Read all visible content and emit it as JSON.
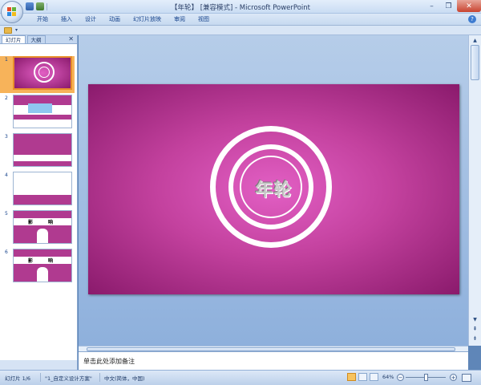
{
  "window": {
    "title": "【年轮】 [兼容模式] - Microsoft PowerPoint",
    "minimize": "–",
    "restore": "❐",
    "close": "✕"
  },
  "ribbon": {
    "tabs": [
      "开始",
      "插入",
      "设计",
      "动画",
      "幻灯片放映",
      "审阅",
      "视图"
    ],
    "help": "?"
  },
  "slides_panel": {
    "tabs": [
      "幻灯片",
      "大纲"
    ],
    "close": "✕",
    "thumbnails": [
      {
        "num": "1",
        "label_a": "",
        "label_b": ""
      },
      {
        "num": "2",
        "label_a": "",
        "label_b": ""
      },
      {
        "num": "3",
        "label_a": "",
        "label_b": ""
      },
      {
        "num": "4",
        "label_a": "",
        "label_b": ""
      },
      {
        "num": "5",
        "label_a": "影",
        "label_b": "响"
      },
      {
        "num": "6",
        "label_a": "影",
        "label_b": "响"
      }
    ]
  },
  "slide": {
    "title": "年轮"
  },
  "notes": {
    "placeholder": "单击此处添加备注"
  },
  "status": {
    "slide_count": "幻灯片 1/6",
    "theme": "\"1_自定义设计方案\"",
    "language": "中文(简体，中国)",
    "zoom": "64%",
    "zoom_minus": "−",
    "zoom_plus": "+"
  },
  "scroll": {
    "up": "▲",
    "down": "▼",
    "prev": "⇞",
    "next": "⇟"
  },
  "colors": {
    "slide_center": "#e25fc4",
    "slide_edge": "#8a1a6c",
    "selection": "#f7b35a"
  },
  "icons": [
    "office-button-icon",
    "save-icon",
    "undo-icon",
    "folder-icon",
    "help-icon",
    "fit-window-icon"
  ]
}
